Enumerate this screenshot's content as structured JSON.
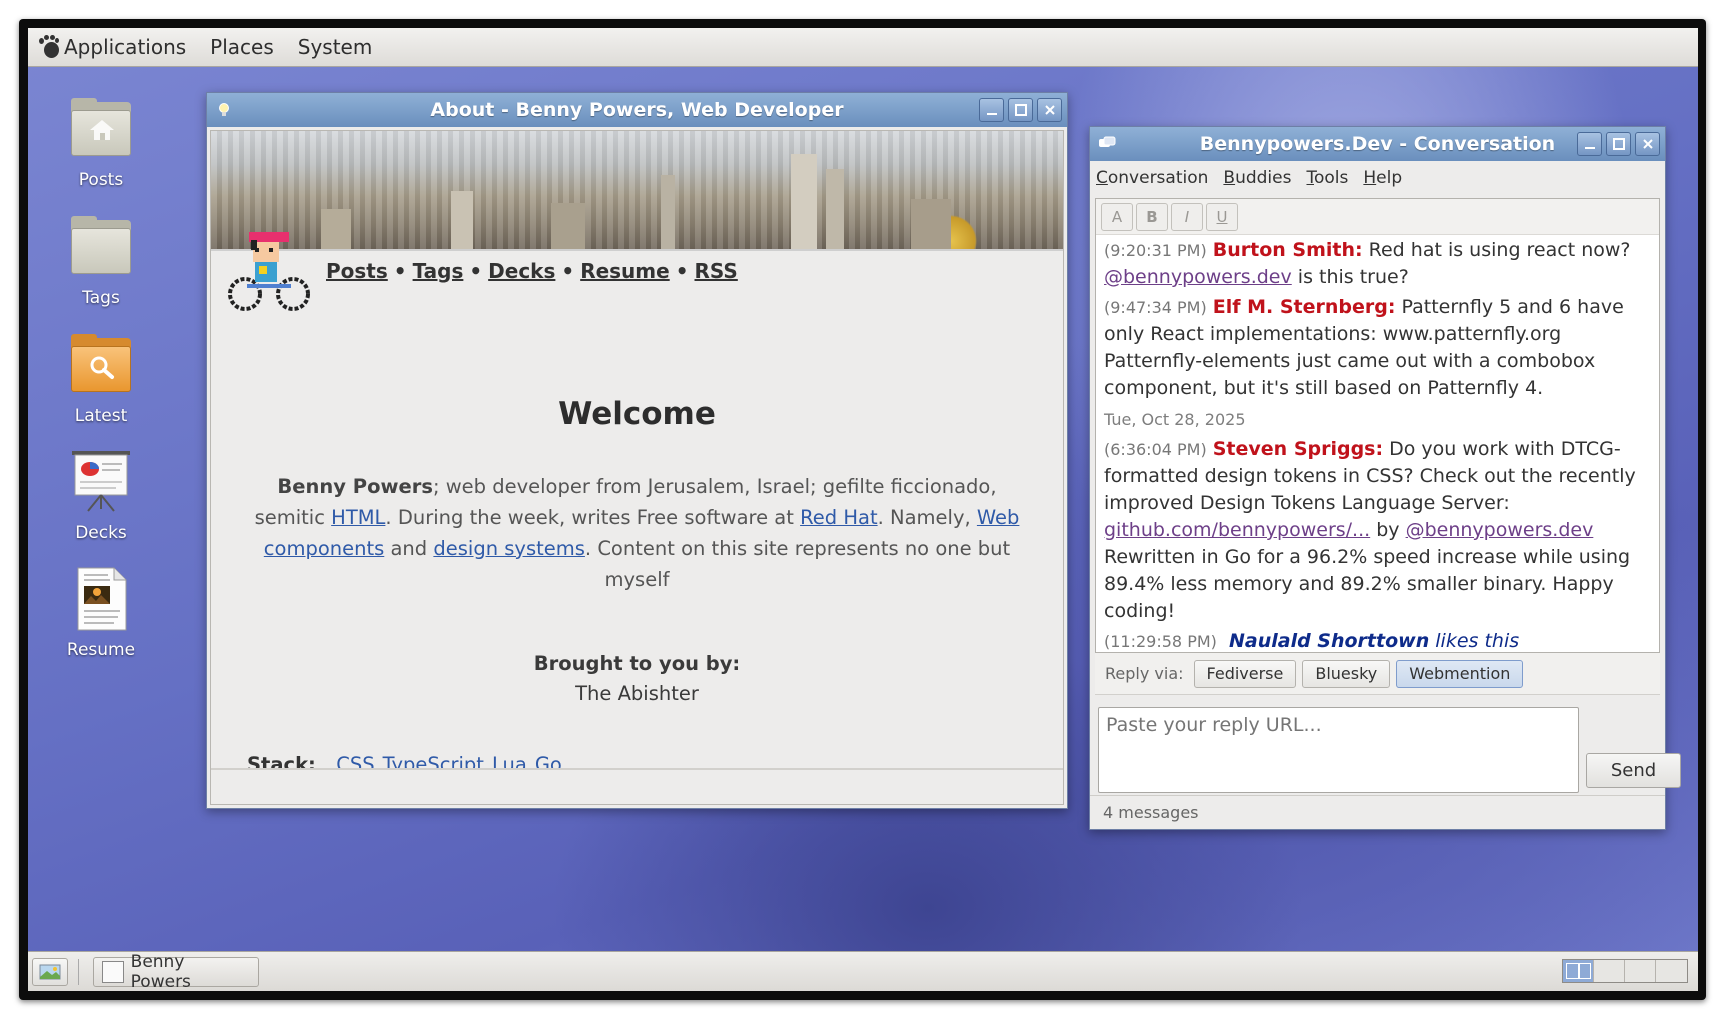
{
  "top_panel": {
    "menus": [
      "Applications",
      "Places",
      "System"
    ]
  },
  "desktop_icons": [
    {
      "label": "Posts",
      "icon": "home-folder-icon"
    },
    {
      "label": "Tags",
      "icon": "folder-icon"
    },
    {
      "label": "Latest",
      "icon": "search-folder-icon"
    },
    {
      "label": "Decks",
      "icon": "presentation-icon"
    },
    {
      "label": "Resume",
      "icon": "document-image-icon"
    }
  ],
  "about_window": {
    "title": "About - Benny Powers, Web Developer",
    "nav": [
      "Posts",
      "Tags",
      "Decks",
      "Resume",
      "RSS"
    ],
    "nav_separator": "•",
    "heading": "Welcome",
    "intro": {
      "name": "Benny Powers",
      "t1": "; web developer from Jerusalem, Israel; gefilte ficcionado, semitic ",
      "link_html": "HTML",
      "t2": ". During the week, writes Free software at ",
      "link_redhat": "Red Hat",
      "t3": ". Namely, ",
      "link_webcomponents": "Web components",
      "t4": " and ",
      "link_designsystems": "design systems",
      "t5": ". Content on this site represents no one but myself"
    },
    "brought_label": "Brought to you by:",
    "brought_name": "The Abishter",
    "stack_label": "Stack:",
    "stack_items": [
      "CSS",
      "TypeScript",
      "Lua",
      "Go"
    ]
  },
  "conversation_window": {
    "title": "Bennypowers.Dev - Conversation",
    "menu": [
      {
        "accel": "C",
        "rest": "onversation"
      },
      {
        "accel": "B",
        "rest": "uddies"
      },
      {
        "accel": "T",
        "rest": "ools"
      },
      {
        "accel": "H",
        "rest": "elp"
      }
    ],
    "format_buttons": [
      "A",
      "B",
      "I",
      "U"
    ],
    "messages": [
      {
        "time": "(9:20:31 PM)",
        "nick": "Burton Smith:",
        "text": " Red hat is using react now? ",
        "link": "@bennypowers.dev",
        "text2": " is this true?"
      },
      {
        "time": "(9:47:34 PM)",
        "nick": "Elf M. Sternberg:",
        "text": " Patternfly 5 and 6 have only React implementations: www.patternfly.org Patternfly-elements just came out with a combobox component, but it's still based on Patternfly 4."
      }
    ],
    "date_separator": "Tue, Oct 28, 2025",
    "message3": {
      "time": "(6:36:04 PM)",
      "nick": "Steven Spriggs:",
      "t1": " Do you work with DTCG-formatted design tokens in CSS? Check out the recently improved Design Tokens Language Server: ",
      "link1": "github.com/bennypowers/...",
      "t2": " by ",
      "link2": "@bennypowers.dev",
      "t3": " Rewritten in Go for a 96.2% speed increase while using 89.4% less memory and 89.2% smaller binary. Happy coding!"
    },
    "like": {
      "time": "(11:29:58 PM)",
      "nick": "Naulald Shorttown",
      "text": "likes this"
    },
    "reply_label": "Reply via:",
    "reply_options": [
      "Fediverse",
      "Bluesky",
      "Webmention"
    ],
    "reply_selected": "Webmention",
    "input_placeholder": "Paste your reply URL...",
    "send_label": "Send",
    "status": "4 messages"
  },
  "bottom_panel": {
    "task_label": "Benny Powers",
    "workspaces": 4,
    "active_workspace": 1
  }
}
